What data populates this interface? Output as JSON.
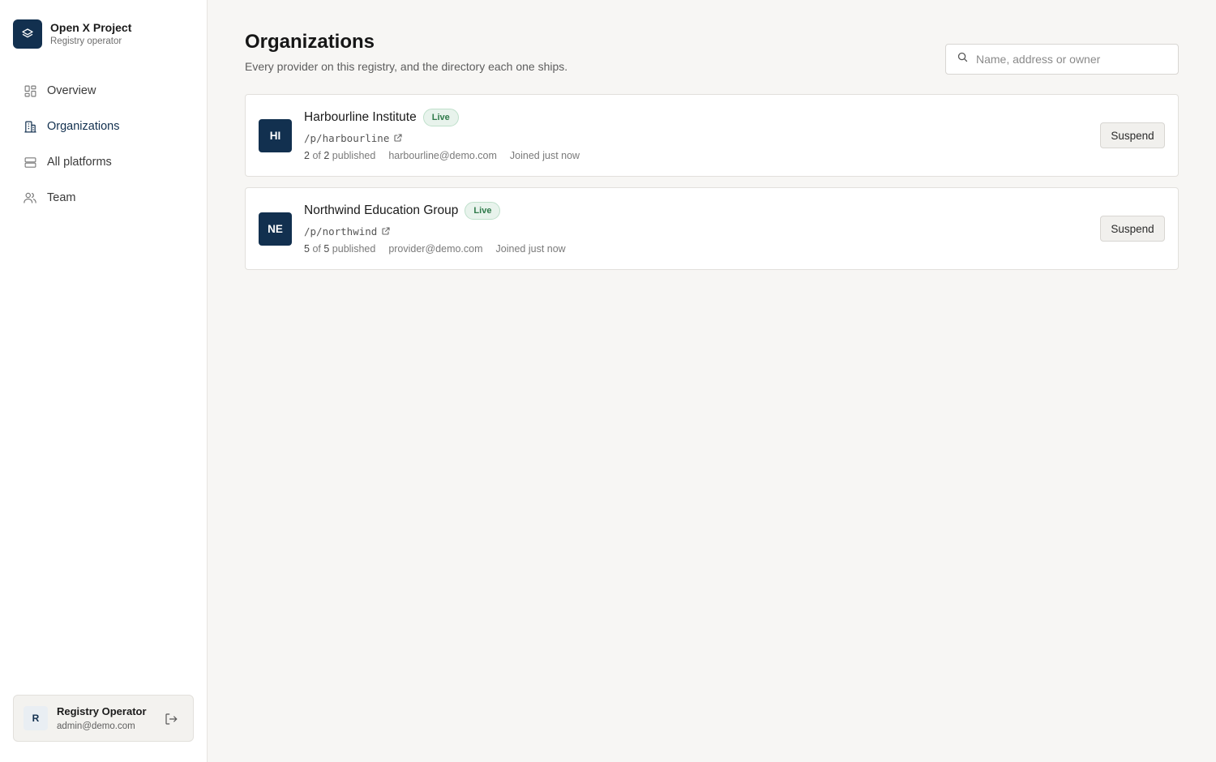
{
  "brand": {
    "name": "Open X Project",
    "subtitle": "Registry operator"
  },
  "nav": {
    "items": [
      {
        "label": "Overview",
        "icon": "grid-icon"
      },
      {
        "label": "Organizations",
        "icon": "building-icon",
        "active": true
      },
      {
        "label": "All platforms",
        "icon": "server-icon"
      },
      {
        "label": "Team",
        "icon": "users-icon"
      }
    ]
  },
  "user": {
    "initial": "R",
    "name": "Registry Operator",
    "email": "admin@demo.com"
  },
  "header": {
    "title": "Organizations",
    "subtitle": "Every provider on this registry, and the directory each one ships."
  },
  "search": {
    "placeholder": "Name, address or owner",
    "value": ""
  },
  "organizations": [
    {
      "initials": "HI",
      "name": "Harbourline Institute",
      "status": "Live",
      "path": "/p/harbourline",
      "published_count": "2",
      "published_total": "2",
      "published_suffix": "published",
      "of": "of",
      "email": "harbourline@demo.com",
      "joined": "Joined just now",
      "action": "Suspend"
    },
    {
      "initials": "NE",
      "name": "Northwind Education Group",
      "status": "Live",
      "path": "/p/northwind",
      "published_count": "5",
      "published_total": "5",
      "published_suffix": "published",
      "of": "of",
      "email": "provider@demo.com",
      "joined": "Joined just now",
      "action": "Suspend"
    }
  ],
  "colors": {
    "brand": "#12304f",
    "live_badge_bg": "#e8f3ec",
    "live_badge_text": "#2f7a4a",
    "page_bg": "#f7f6f4"
  }
}
